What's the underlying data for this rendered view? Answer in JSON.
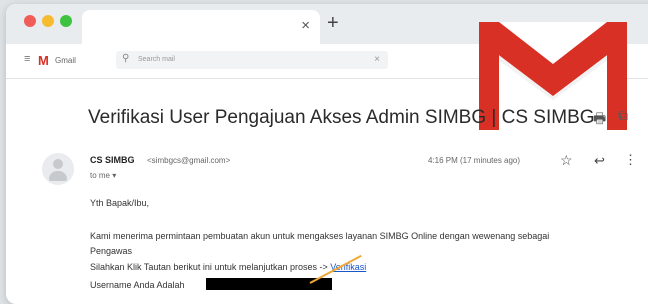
{
  "browser": {
    "tab_close": "×",
    "new_tab": "+"
  },
  "toolbar": {
    "gmail_label": "Gmail",
    "search_placeholder": "Search mail"
  },
  "email": {
    "subject": "Verifikasi User Pengajuan Akses Admin SIMBG | CS SIMBG",
    "sender_name": "CS SIMBG",
    "sender_email": "<simbgcs@gmail.com>",
    "to": "to me ▾",
    "time": "4:16 PM (17 minutes ago)",
    "greeting": "Yth Bapak/Ibu,",
    "para1_line1": "Kami menerima permintaan pembuatan akun untuk mengakses layanan SIMBG Online dengan wewenang sebagai",
    "para1_line2": "Pengawas",
    "para2_prefix": "Silahkan Klik Tautan berikut ini untuk melanjutkan proses -> ",
    "para2_link": "Verifikasi",
    "para3": "Username Anda Adalah"
  },
  "colors": {
    "gmail_red": "#d93025",
    "link_blue": "#1a56c8",
    "annotation_arrow": "#f0a836"
  },
  "icons": [
    "menu-icon",
    "search-icon",
    "print-icon",
    "open-in-new-icon",
    "star-icon",
    "reply-icon",
    "more-icon",
    "gmail-logo"
  ]
}
